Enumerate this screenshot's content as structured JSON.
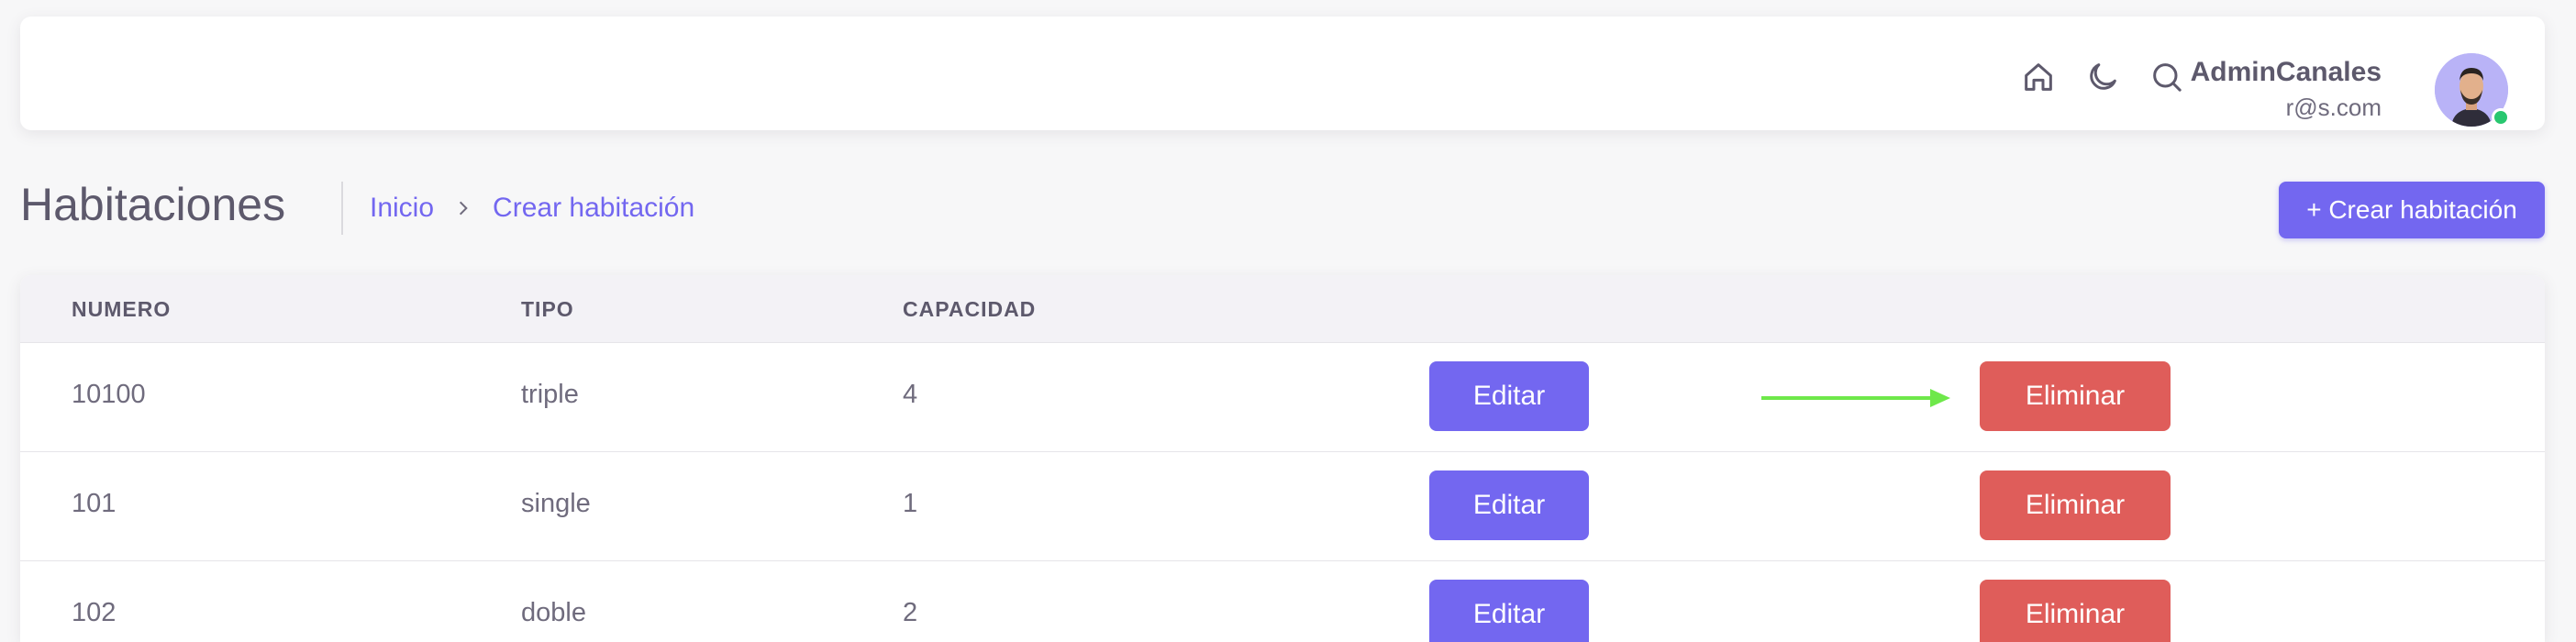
{
  "navbar": {
    "icons": [
      "home-icon",
      "moon-icon",
      "search-icon"
    ],
    "user": {
      "name": "AdminCanales",
      "email": "r@s.com",
      "status_color": "#28c76f"
    }
  },
  "page": {
    "title": "Habitaciones",
    "breadcrumb": [
      "Inicio",
      "Crear habitación"
    ],
    "create_button": "+ Crear habitación"
  },
  "table": {
    "headers": [
      "NUMERO",
      "TIPO",
      "CAPACIDAD"
    ],
    "rows": [
      {
        "numero": "10100",
        "tipo": "triple",
        "capacidad": "4",
        "edit": "Editar",
        "delete": "Eliminar"
      },
      {
        "numero": "101",
        "tipo": "single",
        "capacidad": "1",
        "edit": "Editar",
        "delete": "Eliminar"
      },
      {
        "numero": "102",
        "tipo": "doble",
        "capacidad": "2",
        "edit": "Editar",
        "delete": "Eliminar"
      }
    ]
  },
  "colors": {
    "primary": "#7367f0",
    "danger": "#df5d5a",
    "annotation_arrow": "#6ee84a"
  }
}
